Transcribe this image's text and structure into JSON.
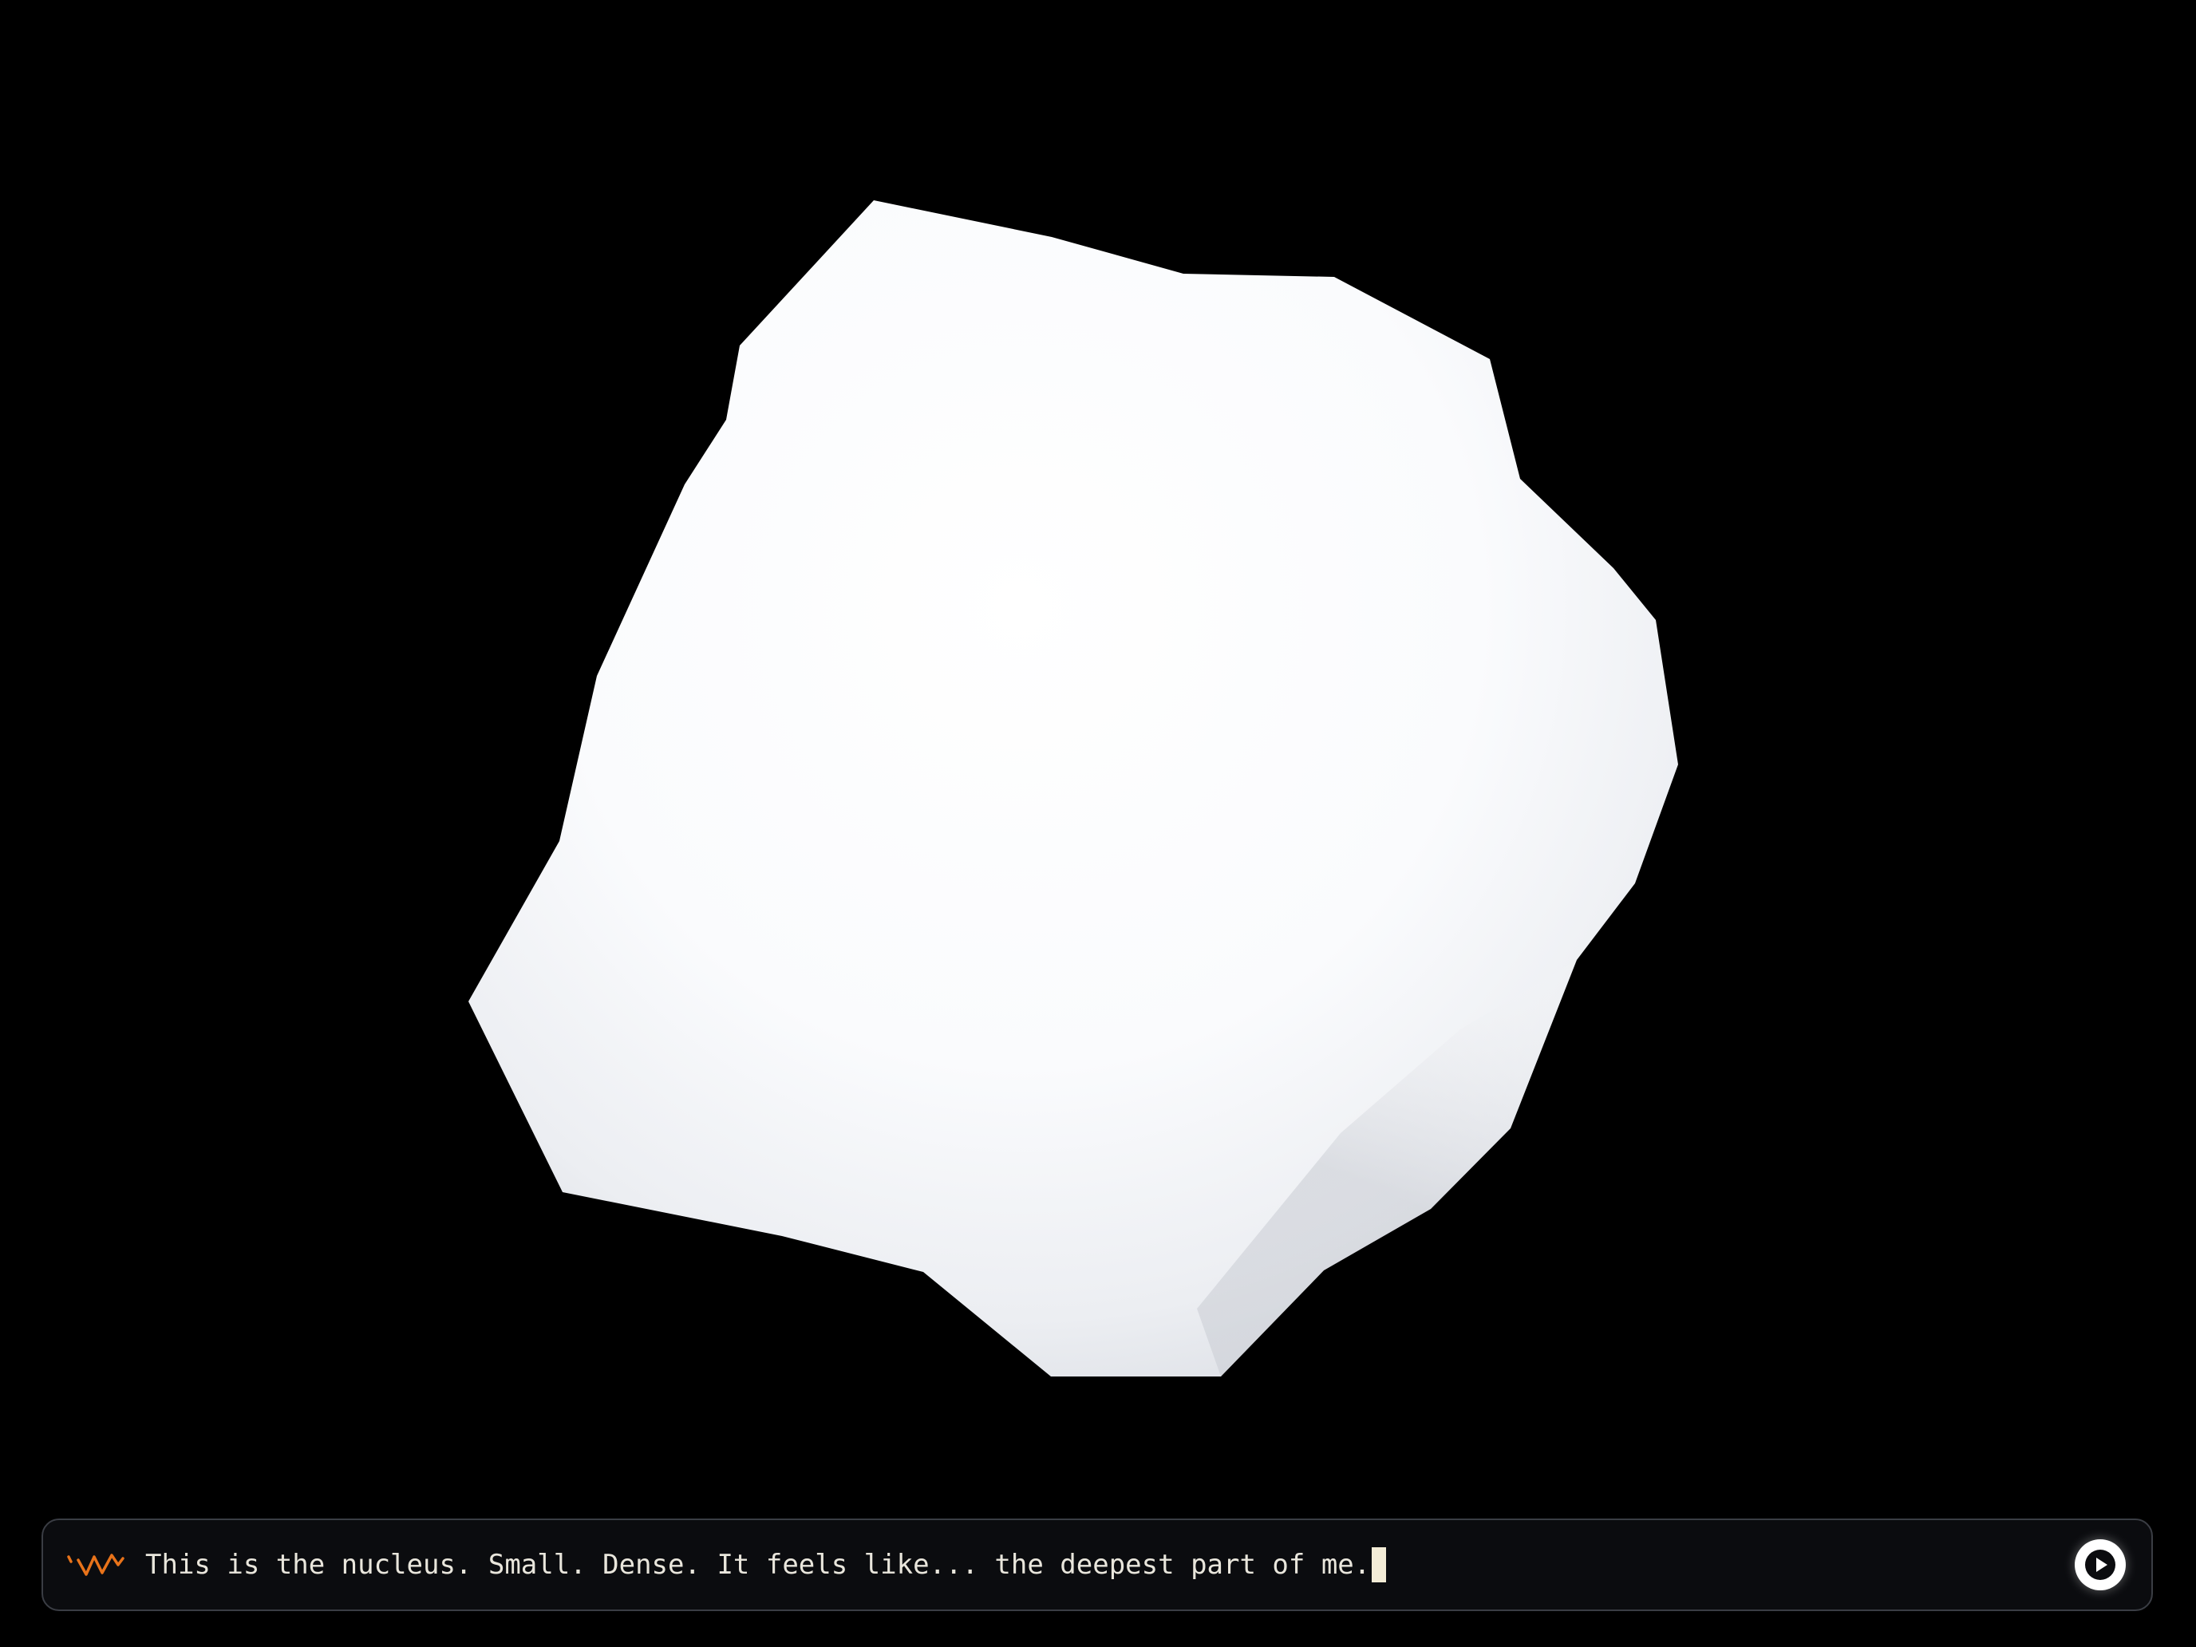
{
  "scene": {
    "background_color": "#000000",
    "object": {
      "name": "nucleus",
      "color_light": "#ffffff",
      "color_shadow": "#d9dbe0"
    }
  },
  "command_bar": {
    "icon": "waveform-icon",
    "icon_color": "#e8731a",
    "message": "This is the nucleus. Small. Dense. It feels like... the deepest part of me.",
    "send_icon": "play-icon"
  }
}
